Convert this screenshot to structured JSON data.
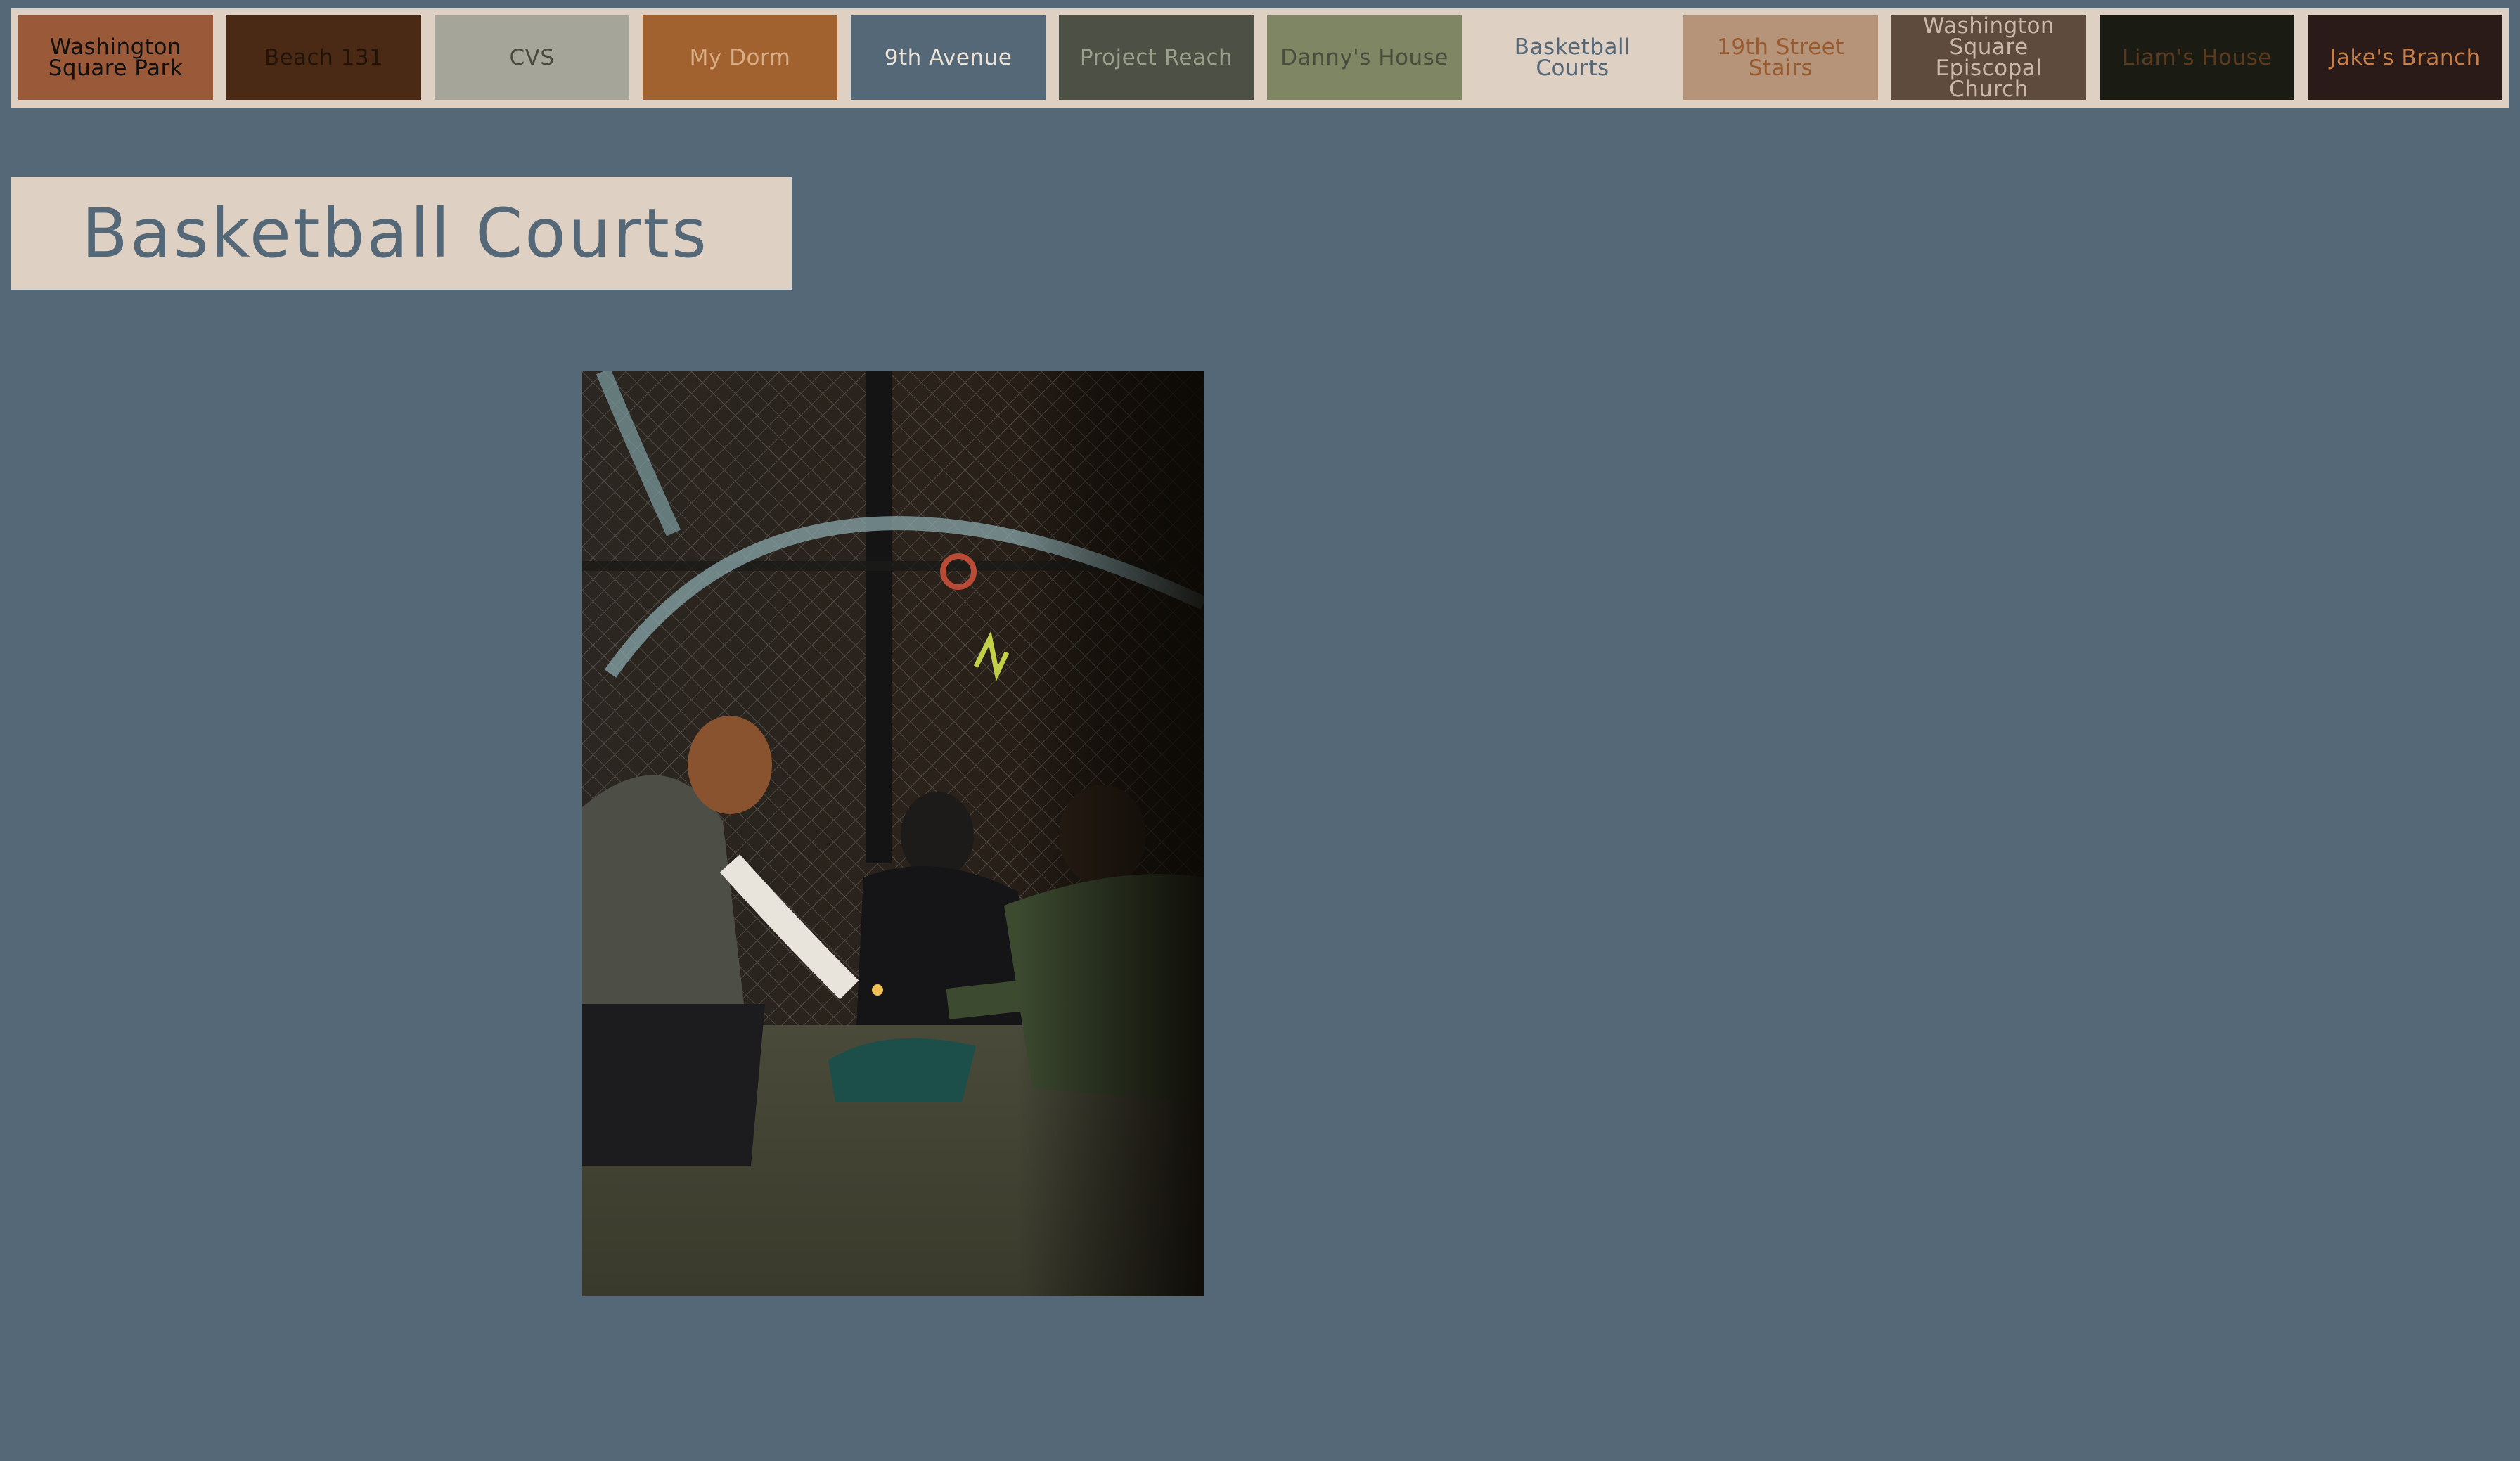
{
  "nav": {
    "items": [
      {
        "label": "Washington Square Park",
        "bg": "#9a5a3a",
        "fg": "#111111"
      },
      {
        "label": "Beach 131",
        "bg": "#4a2a15",
        "fg": "#221309"
      },
      {
        "label": "CVS",
        "bg": "#a6a59a",
        "fg": "#4a4a3c"
      },
      {
        "label": "My Dorm",
        "bg": "#a26230",
        "fg": "#d9ad84"
      },
      {
        "label": "9th Avenue",
        "bg": "#556878",
        "fg": "#ece4d8"
      },
      {
        "label": "Project Reach",
        "bg": "#4d5045",
        "fg": "#9aa08a"
      },
      {
        "label": "Danny's House",
        "bg": "#7e8663",
        "fg": "#4a4d3e"
      },
      {
        "label": "Basketball Courts",
        "bg": "#ded0c3",
        "fg": "#556878"
      },
      {
        "label": "19th Street Stairs",
        "bg": "#b59479",
        "fg": "#9a5a30"
      },
      {
        "label": "Washington Square Episcopal Church",
        "bg": "#5e4b3e",
        "fg": "#c9b9a8"
      },
      {
        "label": "Liam's House",
        "bg": "#1a1c14",
        "fg": "#5c3a1e"
      },
      {
        "label": "Jake's Branch",
        "bg": "#2a1b18",
        "fg": "#c67f4a"
      }
    ]
  },
  "page": {
    "title": "Basketball Courts",
    "accent": "#556878",
    "panel": "#ded0c3"
  },
  "photo": {
    "subject-icon": "photo-basketball-court-group"
  }
}
